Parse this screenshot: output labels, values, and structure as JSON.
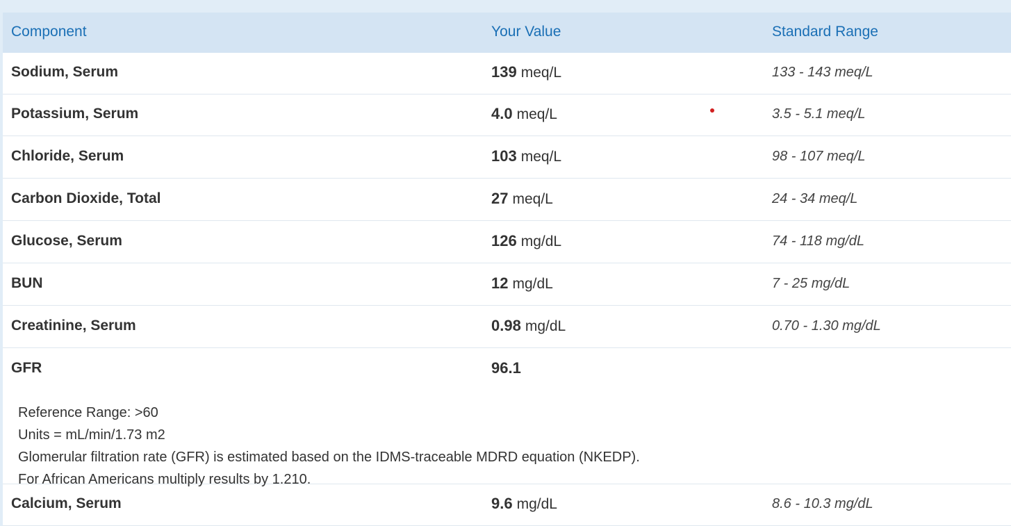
{
  "header": {
    "component": "Component",
    "your_value": "Your Value",
    "standard_range": "Standard Range"
  },
  "rows": [
    {
      "name": "Sodium, Serum",
      "value": "139",
      "unit": "meq/L",
      "range": "133 - 143 meq/L"
    },
    {
      "name": "Potassium, Serum",
      "value": "4.0",
      "unit": "meq/L",
      "range": "3.5 - 5.1 meq/L"
    },
    {
      "name": "Chloride, Serum",
      "value": "103",
      "unit": "meq/L",
      "range": "98 - 107 meq/L"
    },
    {
      "name": "Carbon Dioxide, Total",
      "value": "27",
      "unit": "meq/L",
      "range": "24 - 34 meq/L"
    },
    {
      "name": "Glucose, Serum",
      "value": "126",
      "unit": "mg/dL",
      "range": "74 - 118 mg/dL"
    },
    {
      "name": "BUN",
      "value": "12",
      "unit": "mg/dL",
      "range": "7 - 25 mg/dL"
    },
    {
      "name": "Creatinine, Serum",
      "value": "0.98",
      "unit": "mg/dL",
      "range": "0.70 - 1.30 mg/dL"
    }
  ],
  "gfr": {
    "name": "GFR",
    "value": "96.1",
    "notes": [
      "Reference Range: >60",
      "Units = mL/min/1.73 m2",
      "Glomerular filtration rate (GFR) is estimated based on the IDMS-traceable MDRD equation (NKEDP).",
      "For African Americans multiply results by 1.210."
    ]
  },
  "calcium": {
    "name": "Calcium, Serum",
    "value": "9.6",
    "unit": "mg/dL",
    "range": "8.6 - 10.3 mg/dL"
  },
  "colors": {
    "header_bg": "#d4e4f3",
    "header_text": "#1a6fb5",
    "indicator_dot": "#d12020"
  }
}
